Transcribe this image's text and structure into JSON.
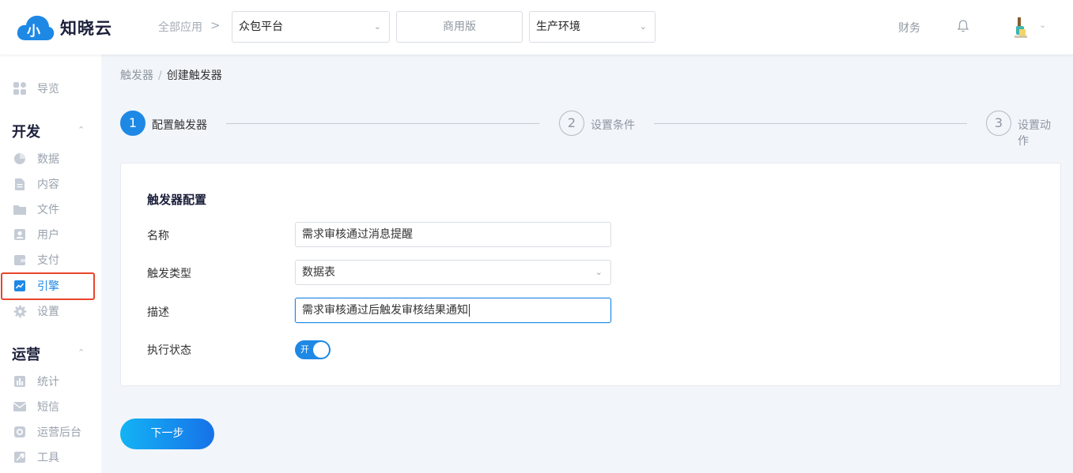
{
  "header": {
    "logo_text": "知晓云",
    "all_apps_label": "全部应用",
    "crumb_arrow": ">",
    "platform_select": "众包平台",
    "edition_label": "商用版",
    "env_select": "生产环境",
    "finance_label": "财务"
  },
  "sidebar": {
    "nav_overview": "导览",
    "group_dev": "开发",
    "dev_items": [
      "数据",
      "内容",
      "文件",
      "用户",
      "支付",
      "引擎",
      "设置"
    ],
    "active_item": "引擎",
    "group_ops": "运营",
    "ops_items": [
      "统计",
      "短信",
      "运营后台",
      "工具"
    ]
  },
  "breadcrumb": {
    "parent": "触发器",
    "separator": "/",
    "current": "创建触发器"
  },
  "steps": [
    {
      "num": "1",
      "label": "配置触发器",
      "active": true
    },
    {
      "num": "2",
      "label": "设置条件",
      "active": false
    },
    {
      "num": "3",
      "label": "设置动作",
      "active": false
    }
  ],
  "form": {
    "title": "触发器配置",
    "name_label": "名称",
    "name_value": "需求审核通过消息提醒",
    "type_label": "触发类型",
    "type_value": "数据表",
    "desc_label": "描述",
    "desc_value": "需求审核通过后触发审核结果通知",
    "status_label": "执行状态",
    "status_toggle_text": "开",
    "status_on": true
  },
  "actions": {
    "next_label": "下一步"
  },
  "colors": {
    "accent": "#1e88e5",
    "highlight_border": "#e8452c"
  }
}
